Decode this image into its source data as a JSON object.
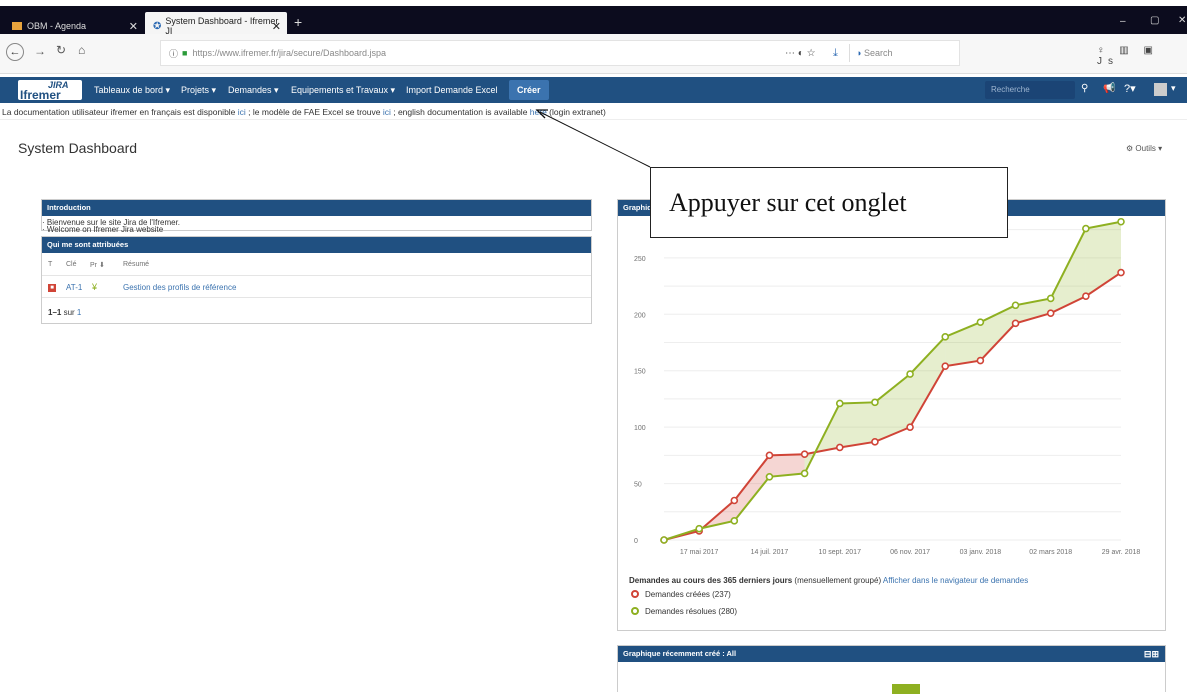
{
  "browser": {
    "tabs": [
      {
        "label": "OBM - Agenda"
      },
      {
        "label": "System Dashboard - Ifremer JI"
      }
    ],
    "new_tab": "+",
    "url": "https://www.ifremer.fr/jira/secure/Dashboard.jspa",
    "url_domain": "ifremer.fr",
    "search_placeholder": "Search"
  },
  "jira": {
    "logo_top": "JIRA",
    "logo_bottom": "Ifremer",
    "menu": [
      "Tableaux de bord ▾",
      "Projets ▾",
      "Demandes ▾",
      "Equipements et Travaux ▾",
      "Import Demande Excel"
    ],
    "create": "Créer",
    "search_placeholder": "Recherche"
  },
  "banner": {
    "t1": "La documentation utilisateur ifremer en français est disponible ",
    "l1": "ici",
    "t2": " ; le modèle de FAE Excel se trouve ",
    "l2": "ici",
    "t3": " ; english documentation is available ",
    "l3": "here",
    "t4": " (login extranet)"
  },
  "page": {
    "title": "System Dashboard",
    "tools": "Outils ▾"
  },
  "intro": {
    "title": "Introduction",
    "lines": [
      "· Bienvenue sur le site Jira de l'Ifremer.",
      "· Welcome on Ifremer Jira website"
    ]
  },
  "assigned": {
    "title": "Qui me sont attribuées",
    "cols": [
      "T",
      "Clé",
      "Pr",
      "Résumé"
    ],
    "row": {
      "key": "AT-1",
      "summary": "Gestion des profils de référence"
    },
    "footer": "1–1",
    "footer_mid": " sur ",
    "footer_total": "1"
  },
  "graph_title": "Graphique créées vs résolues",
  "chart_data": {
    "type": "area",
    "x": [
      "17 mai 2017",
      "14 juil. 2017",
      "10 sept. 2017",
      "06 nov. 2017",
      "03 janv. 2018",
      "02 mars 2018",
      "29 avr. 2018"
    ],
    "yticks": [
      0,
      50,
      100,
      150,
      200,
      250
    ],
    "ylim": [
      0,
      280
    ],
    "series": [
      {
        "name": "Demandes créées (237)",
        "color": "#d04437",
        "values": [
          0,
          8,
          35,
          75,
          76,
          82,
          87,
          100,
          154,
          159,
          192,
          201,
          216,
          237
        ]
      },
      {
        "name": "Demandes résolues (280)",
        "color": "#8eb021",
        "values": [
          0,
          10,
          17,
          56,
          59,
          121,
          122,
          147,
          180,
          193,
          208,
          214,
          276,
          282
        ]
      }
    ]
  },
  "chart_caption": {
    "bold": "Demandes au cours des 365 derniers jours",
    "rest": " (mensuellement groupé) ",
    "link": "Afficher dans le navigateur de demandes"
  },
  "recent": {
    "title": "Graphique récemment créé : All"
  },
  "callout": "Appuyer sur cet onglet"
}
